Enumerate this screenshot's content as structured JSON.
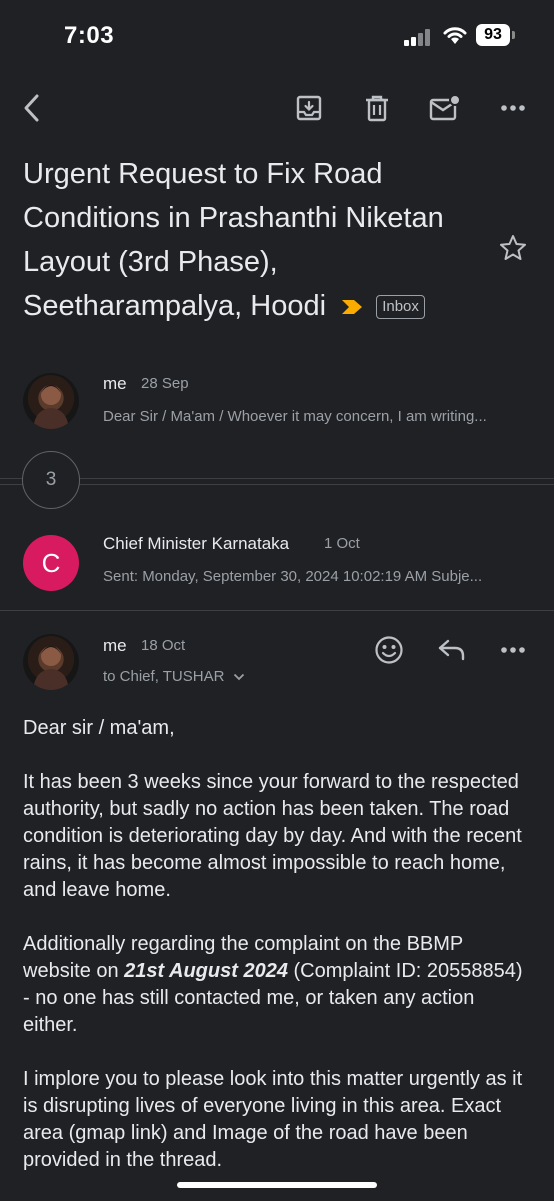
{
  "status": {
    "time": "7:03",
    "battery": "93"
  },
  "email": {
    "subject": "Urgent Request to Fix Road Conditions in Prashanthi Niketan Layout (3rd Phase), Seetharampalya, Hoodi",
    "label": "Inbox"
  },
  "thread": {
    "collapsed_count": "3",
    "messages": [
      {
        "sender": "me",
        "date": "28 Sep",
        "snippet": "Dear Sir / Ma'am / Whoever it may concern, I am writing..."
      },
      {
        "sender": "Chief Minister Karnataka",
        "avatar_letter": "C",
        "date": "1 Oct",
        "snippet": "Sent: Monday, September 30, 2024 10:02:19 AM Subje..."
      },
      {
        "sender": "me",
        "date": "18 Oct",
        "recipients": "to Chief, TUSHAR",
        "body": {
          "greeting": "Dear sir / ma'am,",
          "p1": "It has been 3 weeks since your forward to the respected authority, but sadly no action has been taken. The road condition is deteriorating day by day. And with the recent rains, it has become almost impossible to reach home, and leave home.",
          "p2_a": "Additionally regarding the complaint on the BBMP website on ",
          "p2_date": "21st August 2024",
          "p2_b": " (Complaint ID: 20558854) - no one has still contacted me, or taken any action either.",
          "p3": "I implore you to please look into this matter urgently as it is disrupting lives of everyone living in this area. Exact area (gmap link) and Image of the road have been provided in the thread."
        }
      }
    ]
  },
  "colors": {
    "background": "#202124",
    "important_marker": "#f9ab00",
    "avatar_c": "#d81b60"
  },
  "icons": [
    "back-arrow-icon",
    "archive-icon",
    "delete-icon",
    "mark-unread-icon",
    "more-icon",
    "star-icon",
    "emoji-reaction-icon",
    "reply-icon",
    "chevron-down-icon"
  ]
}
